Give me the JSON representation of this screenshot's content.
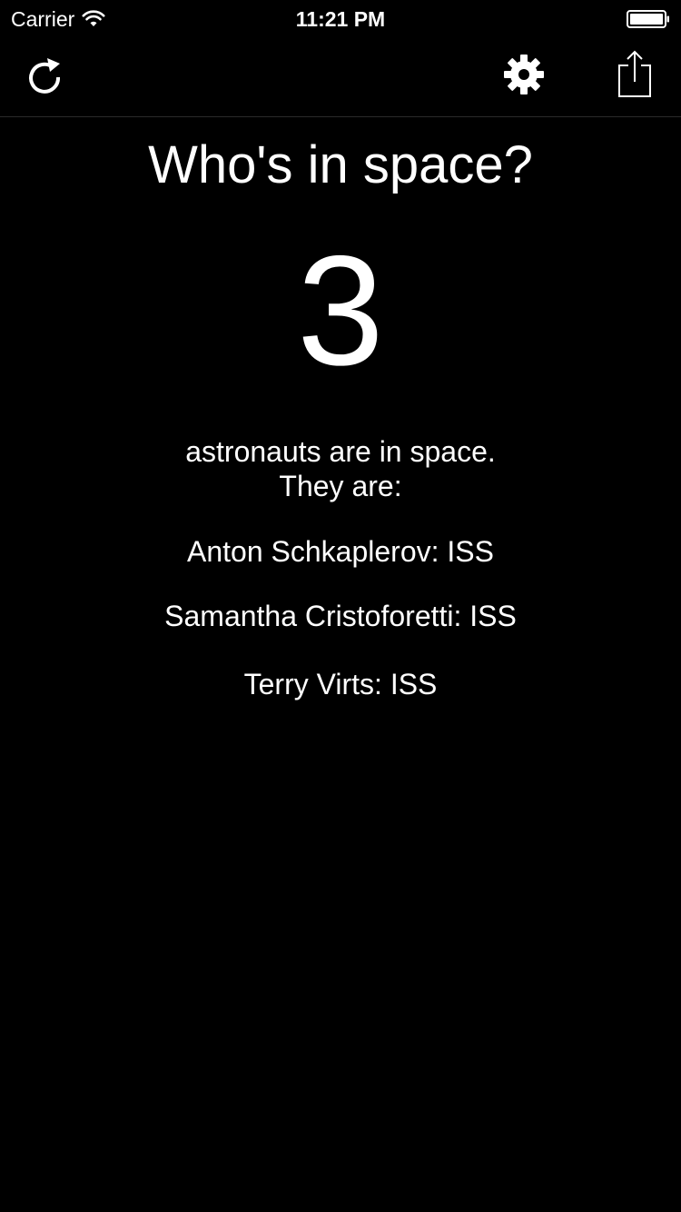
{
  "status_bar": {
    "carrier": "Carrier",
    "time": "11:21 PM"
  },
  "toolbar": {
    "icons": [
      "refresh-icon",
      "gear-icon",
      "share-icon"
    ]
  },
  "main": {
    "title": "Who's in space?",
    "count": "3",
    "subtitle_line1": "astronauts are in space.",
    "subtitle_line2": "They are:",
    "astronauts": [
      "Anton Schkaplerov: ISS",
      "Samantha Cristoforetti: ISS",
      "Terry Virts: ISS"
    ]
  },
  "colors": {
    "background": "#000000",
    "text": "#ffffff"
  }
}
